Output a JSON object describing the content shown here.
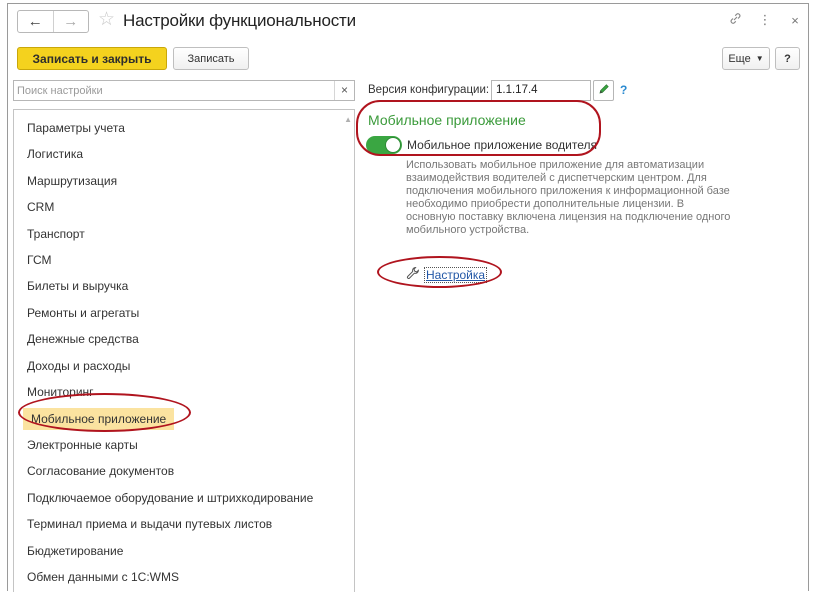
{
  "window": {
    "title": "Настройки функциональности",
    "nav_back_icon": "arrow-left-icon",
    "nav_forward_icon": "arrow-right-icon",
    "favorite_icon": "star-icon",
    "link_icon": "link-icon",
    "menu_icon": "more-vertical-icon",
    "close_icon": "close-icon"
  },
  "toolbar": {
    "save_close_label": "Записать и закрыть",
    "save_label": "Записать",
    "more_label": "Еще",
    "help_label": "?"
  },
  "search": {
    "placeholder": "Поиск настройки",
    "value": ""
  },
  "version": {
    "label": "Версия конфигурации:",
    "value": "1.1.17.4"
  },
  "sections": {
    "selected": "Мобильное приложение",
    "items": [
      "Параметры учета",
      "Логистика",
      "Маршрутизация",
      "CRM",
      "Транспорт",
      "ГСМ",
      "Билеты и выручка",
      "Ремонты и агрегаты",
      "Денежные средства",
      "Доходы и расходы",
      "Мониторинг",
      "Мобильное приложение",
      "Электронные карты",
      "Согласование документов",
      "Подключаемое оборудование и штрихкодирование",
      "Терминал приема и выдачи путевых листов",
      "Бюджетирование",
      "Обмен данными с 1С:WMS"
    ]
  },
  "panel": {
    "title": "Мобильное приложение",
    "toggle_label": "Мобильное приложение водителя",
    "toggle_on": true,
    "description": "Использовать мобильное приложение для автоматизации взаимодействия водителей с диспетчерским центром. Для подключения мобильного приложения к информационной базе необходимо приобрести дополнительные лицензии. В основную поставку включена лицензия на подключение одного мобильного устройства.",
    "setup_link": "Настройка"
  },
  "colors": {
    "accent_yellow": "#f4d21e",
    "toggle_green": "#3aa642",
    "title_green": "#3a9a3a",
    "link_blue": "#2257a6",
    "highlight_red": "#b0141e",
    "selection_bg": "#fbe3a0"
  }
}
